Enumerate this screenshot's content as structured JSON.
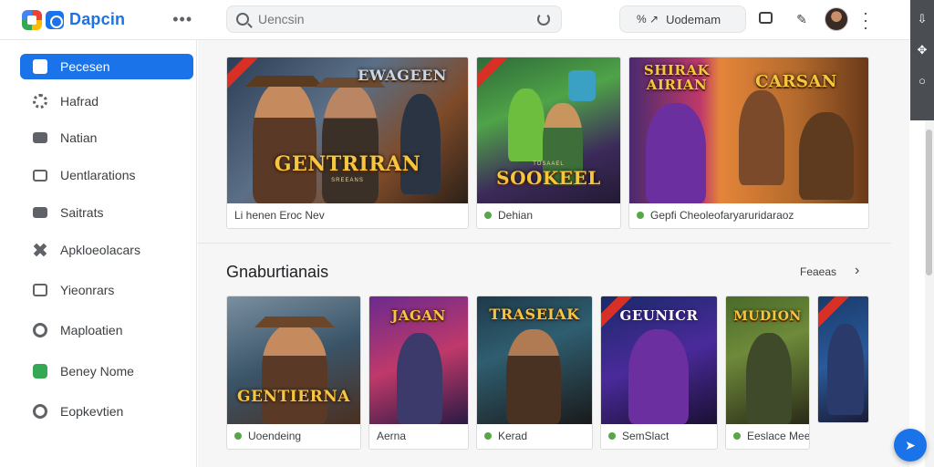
{
  "app": {
    "name": "Dapcin",
    "search_placeholder": "Uencsin",
    "user_pill": "Uodemam",
    "user_pill_glyphs": "% ↗"
  },
  "sidebar": {
    "items": [
      {
        "label": "Pecesen",
        "icon": "store-icon",
        "active": true
      },
      {
        "label": "Hafrad",
        "icon": "gear-icon"
      },
      {
        "label": "Natian",
        "icon": "mail-icon"
      },
      {
        "label": "Uentlarations",
        "icon": "inbox-icon"
      },
      {
        "label": "Saitrats",
        "icon": "mail-icon"
      },
      {
        "label": "Apkloeolacars",
        "icon": "puzzle-icon"
      },
      {
        "label": "Yieonrars",
        "icon": "upload-icon"
      },
      {
        "label": "Maploatien",
        "icon": "location-icon"
      },
      {
        "label": "Beney Nome",
        "icon": "shield-icon"
      },
      {
        "label": "Eopkevtien",
        "icon": "circle-icon"
      }
    ]
  },
  "featured": [
    {
      "art_title": "GENTRIRAN",
      "art_top": "EWAGEEN",
      "art_sub": "SREEANS",
      "caption": "Li henen Eroc Nev",
      "dot": false
    },
    {
      "art_title": "SOOKEEL",
      "art_top": "",
      "art_sub": "TOSAAEL",
      "caption": "Dehian",
      "dot": true
    },
    {
      "art_title": "CARSAN",
      "art_top": "SHIRAK AIRIAN",
      "art_sub": "",
      "caption": "Gepfi Cheoleofaryaruridaraoz",
      "dot": true
    }
  ],
  "section": {
    "title": "Gnaburtianais",
    "see_more": "Feaeas"
  },
  "row": [
    {
      "art_title": "GENTIERNA",
      "caption": "Uoendeing",
      "dot": true
    },
    {
      "art_title": "JAGAN",
      "caption": "Aerna",
      "dot": false
    },
    {
      "art_title": "TRASEIAK",
      "caption": "Kerad",
      "dot": true
    },
    {
      "art_title": "GEUNICR",
      "caption": "SemSlact",
      "dot": true
    },
    {
      "art_title": "MUDION",
      "caption": "Eeslace Mee",
      "dot": true
    },
    {
      "art_title": "",
      "caption": "",
      "dot": false
    }
  ]
}
